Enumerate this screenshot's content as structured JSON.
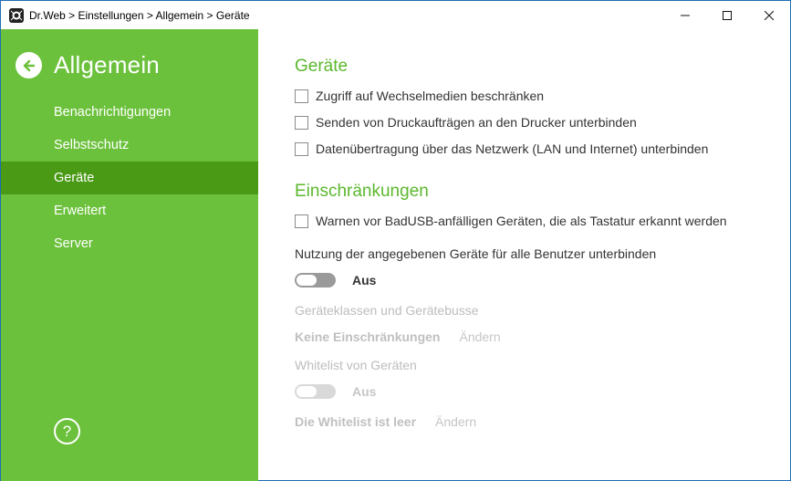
{
  "window": {
    "title": "Dr.Web > Einstellungen > Allgemein > Geräte"
  },
  "sidebar": {
    "title": "Allgemein",
    "items": [
      {
        "label": "Benachrichtigungen"
      },
      {
        "label": "Selbstschutz"
      },
      {
        "label": "Geräte",
        "active": true
      },
      {
        "label": "Erweitert"
      },
      {
        "label": "Server"
      }
    ],
    "help_label": "?"
  },
  "devices": {
    "title": "Geräte",
    "options": [
      {
        "label": "Zugriff auf Wechselmedien beschränken",
        "checked": false
      },
      {
        "label": "Senden von Druckaufträgen an den Drucker unterbinden",
        "checked": false
      },
      {
        "label": "Datenübertragung über das Netzwerk (LAN und Internet) unterbinden",
        "checked": false
      }
    ]
  },
  "restrictions": {
    "title": "Einschränkungen",
    "badusb_label": "Warnen vor BadUSB-anfälligen Geräten, die als Tastatur erkannt werden",
    "block_all_text": "Nutzung der angegebenen Geräte für alle Benutzer unterbinden",
    "toggle_label": "Aus",
    "classes_heading": "Geräteklassen und Gerätebusse",
    "classes_value": "Keine Einschränkungen",
    "change_label": "Ändern",
    "whitelist_heading": "Whitelist von Geräten",
    "whitelist_toggle_label": "Aus",
    "whitelist_value": "Die Whitelist ist leer",
    "whitelist_change_label": "Ändern"
  },
  "colors": {
    "sidebar": "#6cc13c",
    "sidebar_active": "#4a9a16",
    "accent": "#5cb82e"
  }
}
